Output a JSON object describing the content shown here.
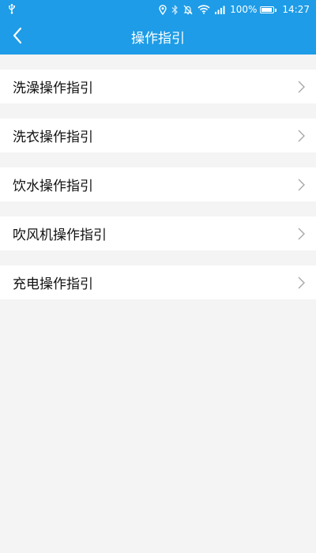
{
  "status": {
    "battery_percent": "100%",
    "battery_level": 1.0,
    "time": "14:27"
  },
  "header": {
    "title": "操作指引",
    "back_icon": "chevron-left-icon"
  },
  "list": {
    "items": [
      {
        "label": "洗澡操作指引",
        "icon": "chevron-right-icon"
      },
      {
        "label": "洗衣操作指引",
        "icon": "chevron-right-icon"
      },
      {
        "label": "饮水操作指引",
        "icon": "chevron-right-icon"
      },
      {
        "label": "吹风机操作指引",
        "icon": "chevron-right-icon"
      },
      {
        "label": "充电操作指引",
        "icon": "chevron-right-icon"
      }
    ]
  },
  "colors": {
    "accent": "#1e9ce7",
    "background": "#f4f4f4",
    "row": "#ffffff",
    "text": "#111111",
    "chevron": "#a8a8a8"
  }
}
